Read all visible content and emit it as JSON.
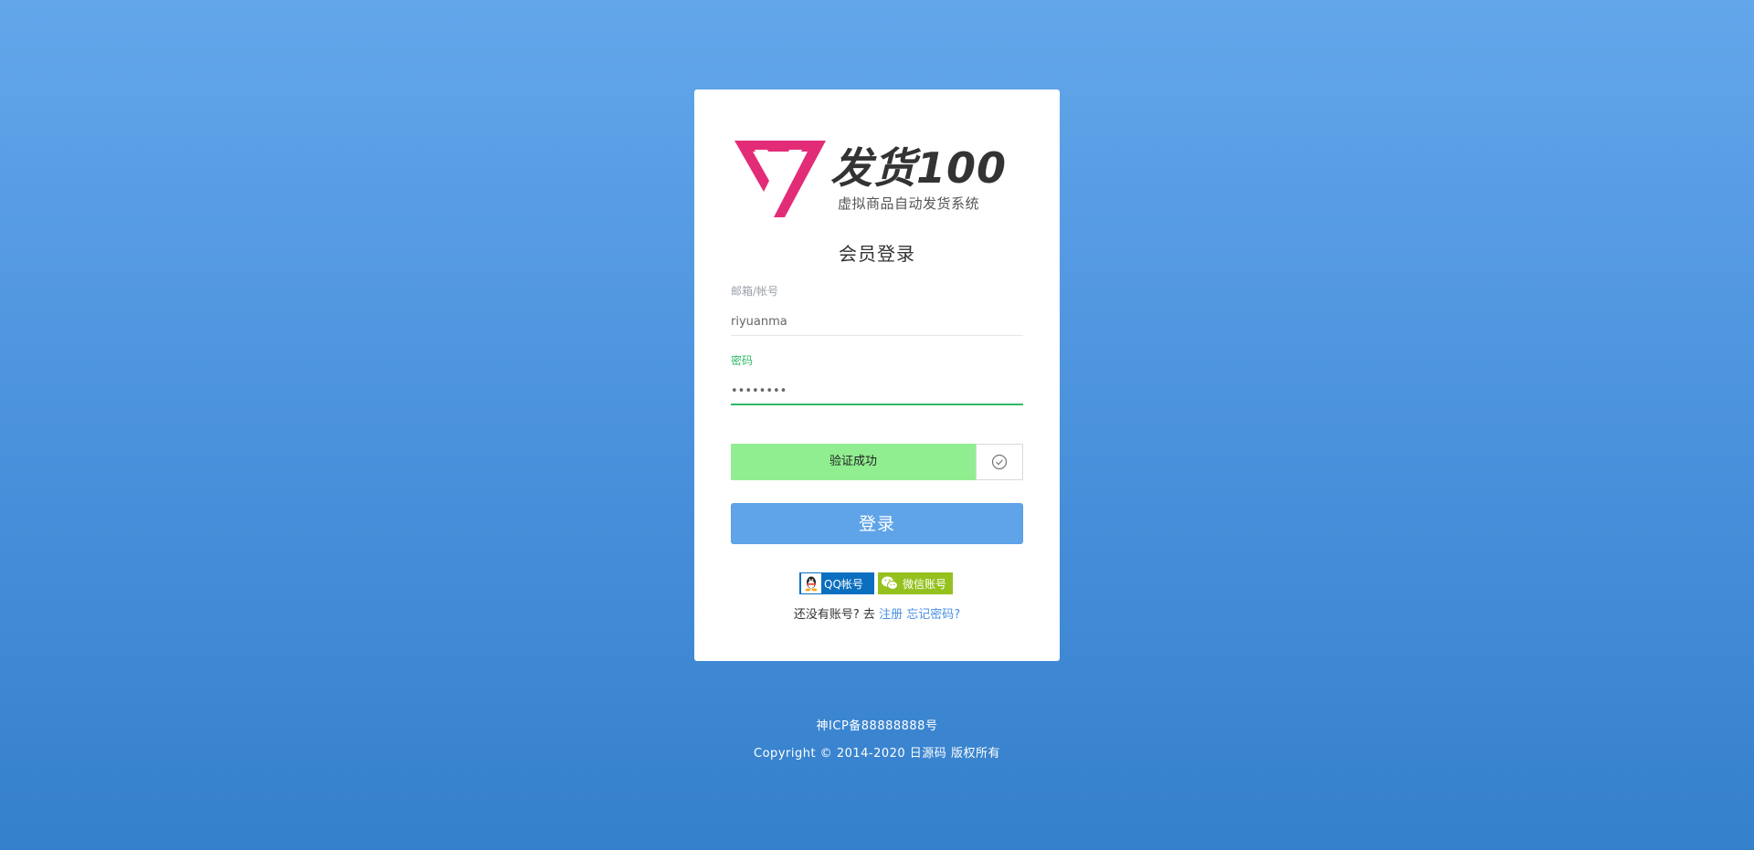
{
  "brand": {
    "name": "发货100",
    "tagline": "虚拟商品自动发货系统",
    "logo_color": "#e32c78"
  },
  "login": {
    "title": "会员登录",
    "account_label": "邮箱/帐号",
    "account_value": "riyuanma",
    "password_label": "密码",
    "password_value": "••••••••",
    "verify_text": "验证成功",
    "verify_bar_color": "#90ee90",
    "submit_label": "登录"
  },
  "social": {
    "qq_label": "QQ帐号",
    "wechat_label": "微信账号"
  },
  "links": {
    "prompt": "还没有账号? 去",
    "register": "注册",
    "forgot": "忘记密码?"
  },
  "footer": {
    "icp": "神ICP备88888888号",
    "copyright": "Copyright © 2014-2020 日源码 版权所有"
  },
  "colors": {
    "background_top": "#63a6ea",
    "background_bottom": "#3580cb",
    "accent_green": "#2fb968",
    "button_blue": "#5fa4e8",
    "qq_blue": "#0b6fc0",
    "wechat_green": "#95c11f"
  }
}
